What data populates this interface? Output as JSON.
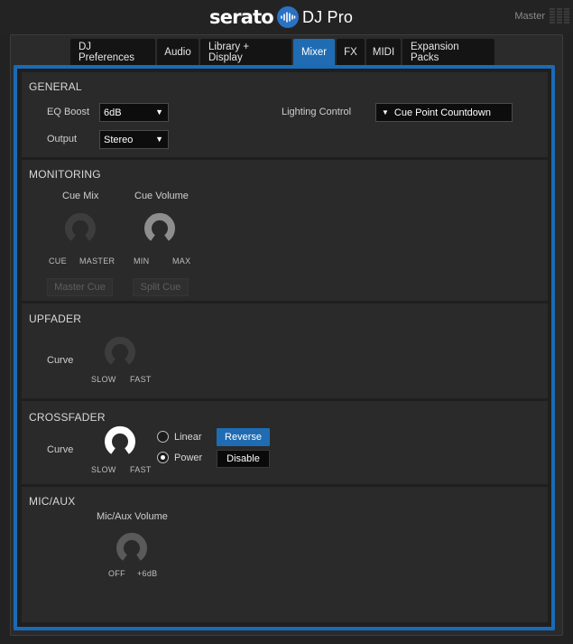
{
  "header": {
    "brand_word": "serato",
    "product": "DJ Pro",
    "master_label": "Master"
  },
  "tabs": [
    {
      "label": "DJ Preferences",
      "active": false
    },
    {
      "label": "Audio",
      "active": false
    },
    {
      "label": "Library + Display",
      "active": false
    },
    {
      "label": "Mixer",
      "active": true
    },
    {
      "label": "FX",
      "active": false
    },
    {
      "label": "MIDI",
      "active": false
    },
    {
      "label": "Expansion Packs",
      "active": false
    }
  ],
  "general": {
    "title": "GENERAL",
    "eq_boost_label": "EQ Boost",
    "eq_boost_value": "6dB",
    "output_label": "Output",
    "output_value": "Stereo",
    "lighting_label": "Lighting Control",
    "lighting_value": "Cue Point Countdown"
  },
  "monitoring": {
    "title": "MONITORING",
    "cue_mix_label": "Cue Mix",
    "cue_volume_label": "Cue Volume",
    "cue_mix_min": "CUE",
    "cue_mix_max": "MASTER",
    "cue_volume_min": "MIN",
    "cue_volume_max": "MAX",
    "master_cue_button": "Master Cue",
    "split_cue_button": "Split Cue"
  },
  "upfader": {
    "title": "UPFADER",
    "curve_label": "Curve",
    "min_label": "SLOW",
    "max_label": "FAST"
  },
  "crossfader": {
    "title": "CROSSFADER",
    "curve_label": "Curve",
    "min_label": "SLOW",
    "max_label": "FAST",
    "option_linear": "Linear",
    "option_power": "Power",
    "selected": "Power",
    "reverse_button": "Reverse",
    "disable_button": "Disable"
  },
  "mic_aux": {
    "title": "MIC/AUX",
    "volume_label": "Mic/Aux Volume",
    "min_label": "OFF",
    "max_label": "+6dB"
  },
  "colors": {
    "accent": "#1f6cb3",
    "background": "#222222",
    "panel": "#2a2a2a"
  }
}
